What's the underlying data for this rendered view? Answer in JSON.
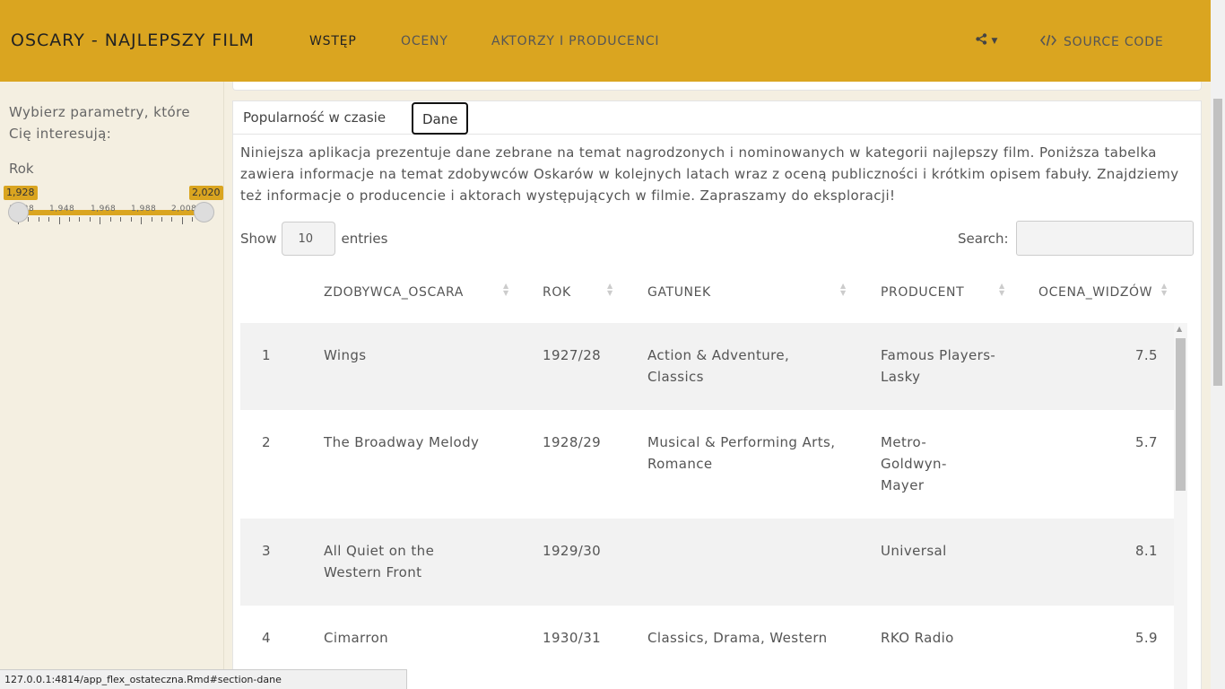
{
  "navbar": {
    "title": "OSCARY - NAJLEPSZY FILM",
    "items": [
      {
        "label": "WSTĘP",
        "active": true
      },
      {
        "label": "OCENY",
        "active": false
      },
      {
        "label": "AKTORZY I PRODUCENCI",
        "active": false
      }
    ],
    "share_icon": "share-icon",
    "source_label": "SOURCE CODE",
    "source_icon": "code-icon",
    "accent_color": "#daa520"
  },
  "sidebar": {
    "intro": "Wybierz parametry, które Cię interesują:",
    "year_label": "Rok",
    "slider": {
      "min": 1928,
      "max": 2020,
      "from": 1928,
      "to": 2020,
      "from_label": "1,928",
      "to_label": "2,020",
      "tick_labels": [
        "1,928",
        "1,948",
        "1,968",
        "1,988",
        "2,008"
      ]
    }
  },
  "tabs": [
    {
      "label": "Popularność w czasie",
      "active": false
    },
    {
      "label": "Dane",
      "active": true
    }
  ],
  "description": "Niniejsza aplikacja prezentuje dane zebrane na temat nagrodzonych i nominowanych w kategorii najlepszy film. Poniższa tabelka zawiera informacje na temat zdobywców Oskarów w kolejnych latach wraz z oceną publiczności i krótkim opisem fabuły. Znajdziemy też informacje o producencie i aktorach występujących w filmie. Zapraszamy do eksploracji!",
  "table_controls": {
    "show_label": "Show",
    "entries_value": "10",
    "entries_label": "entries",
    "search_label": "Search:",
    "search_value": ""
  },
  "table": {
    "columns": [
      "",
      "ZDOBYWCA_OSCARA",
      "ROK",
      "GATUNEK",
      "PRODUCENT",
      "OCENA_WIDZÓW"
    ],
    "rows": [
      {
        "n": "1",
        "title": "Wings",
        "year": "1927/28",
        "genre": "Action & Adventure, Classics",
        "producer": "Famous Players-Lasky",
        "rating": "7.5"
      },
      {
        "n": "2",
        "title": "The Broadway Melody",
        "year": "1928/29",
        "genre": "Musical & Performing Arts, Romance",
        "producer": "Metro-Goldwyn-Mayer",
        "rating": "5.7"
      },
      {
        "n": "3",
        "title": "All Quiet on the Western Front",
        "year": "1929/30",
        "genre": "",
        "producer": "Universal",
        "rating": "8.1"
      },
      {
        "n": "4",
        "title": "Cimarron",
        "year": "1930/31",
        "genre": "Classics, Drama, Western",
        "producer": "RKO Radio",
        "rating": "5.9"
      }
    ]
  },
  "status_url": "127.0.0.1:4814/app_flex_ostateczna.Rmd#section-dane"
}
